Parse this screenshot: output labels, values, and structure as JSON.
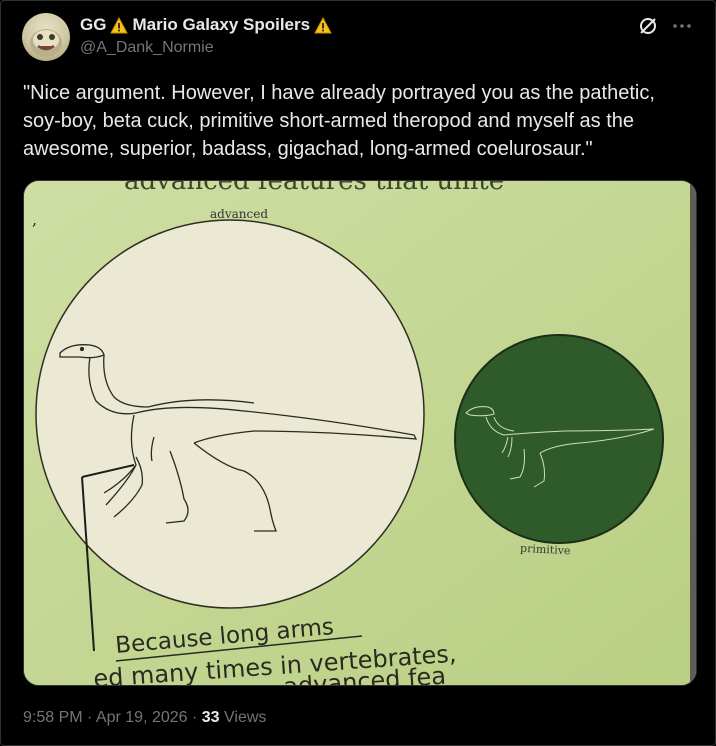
{
  "post": {
    "author": {
      "display_name_part1": "GG",
      "display_name_part2": "Mario Galaxy Spoilers",
      "handle": "@A_Dank_Normie",
      "warning_icon": "warning-icon"
    },
    "text": "\"Nice argument. However, I have already portrayed you as the pathetic, soy-boy, beta cuck, primitive short-armed theropod and myself as the awesome, superior, badass, gigachad, long-armed coelurosaur.\"",
    "media": {
      "heading_partial": "advanced features that unite",
      "label_advanced": "advanced",
      "label_primitive": "primitive",
      "caption_line1": "Because long arms",
      "caption_line2": "ed many times in vertebrates,",
      "caption_line3": "advanced fea"
    },
    "timestamp": "9:58 PM · Apr 19, 2026 · ",
    "views_count": "33",
    "views_label": " Views"
  },
  "colors": {
    "background": "#000000",
    "text_primary": "#e7e9ea",
    "text_secondary": "#71767b",
    "poster_green": "#c7d897",
    "circle_dark_green": "#2f5a2a",
    "circle_light": "#ebe8d4"
  }
}
